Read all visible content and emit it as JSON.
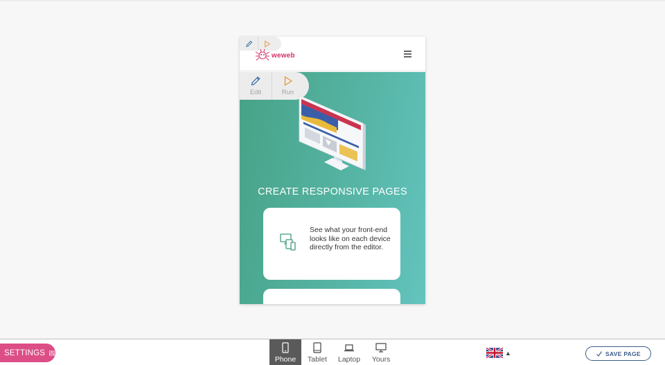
{
  "preview": {
    "logo_text": "weweb",
    "hero": {
      "title": "CREATE RESPONSIVE PAGES",
      "card_text": "See what your front-end looks like on each device directly from the editor."
    },
    "tools": {
      "edit_label": "Edit",
      "run_label": "Run"
    }
  },
  "toolbar": {
    "settings_label": "SETTINGS",
    "devices": [
      {
        "label": "Phone",
        "icon": "phone-icon",
        "active": true
      },
      {
        "label": "Tablet",
        "icon": "tablet-icon",
        "active": false
      },
      {
        "label": "Laptop",
        "icon": "laptop-icon",
        "active": false
      },
      {
        "label": "Yours",
        "icon": "monitor-icon",
        "active": false
      }
    ],
    "language_icon": "uk-flag-icon",
    "save_label": "SAVE PAGE"
  },
  "colors": {
    "accent": "#dc4e86",
    "hero_start": "#47a286",
    "hero_end": "#63c4bf",
    "save_border": "#3d5b8a"
  }
}
